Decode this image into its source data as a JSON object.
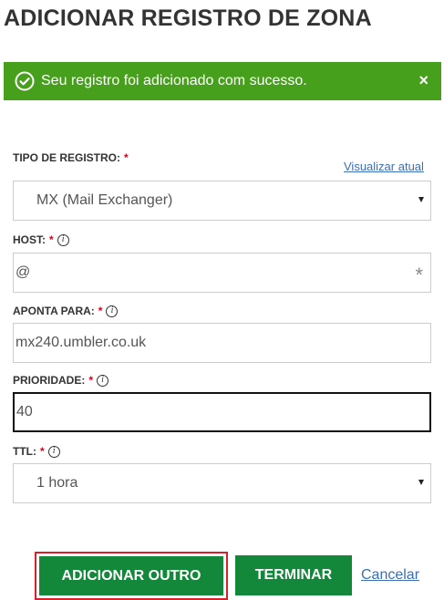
{
  "page": {
    "title": "ADICIONAR REGISTRO DE ZONA"
  },
  "alert": {
    "message": "Seu registro foi adicionado com sucesso.",
    "close": "×",
    "color": "#46a01b"
  },
  "form": {
    "record_type": {
      "label": "TIPO DE REGISTRO:",
      "required_mark": "*",
      "view_link": "Visualizar atual",
      "value": "MX (Mail Exchanger)"
    },
    "host": {
      "label": "HOST:",
      "required_mark": "*",
      "value": "@",
      "suffix": "*"
    },
    "points_to": {
      "label": "APONTA PARA:",
      "required_mark": "*",
      "value": "mx240.umbler.co.uk"
    },
    "priority": {
      "label": "PRIORIDADE:",
      "required_mark": "*",
      "value": "40"
    },
    "ttl": {
      "label": "TTL:",
      "required_mark": "*",
      "value": "1 hora"
    }
  },
  "actions": {
    "add_another": "ADICIONAR OUTRO",
    "finish": "TERMINAR",
    "cancel": "Cancelar",
    "button_color": "#13883a"
  }
}
